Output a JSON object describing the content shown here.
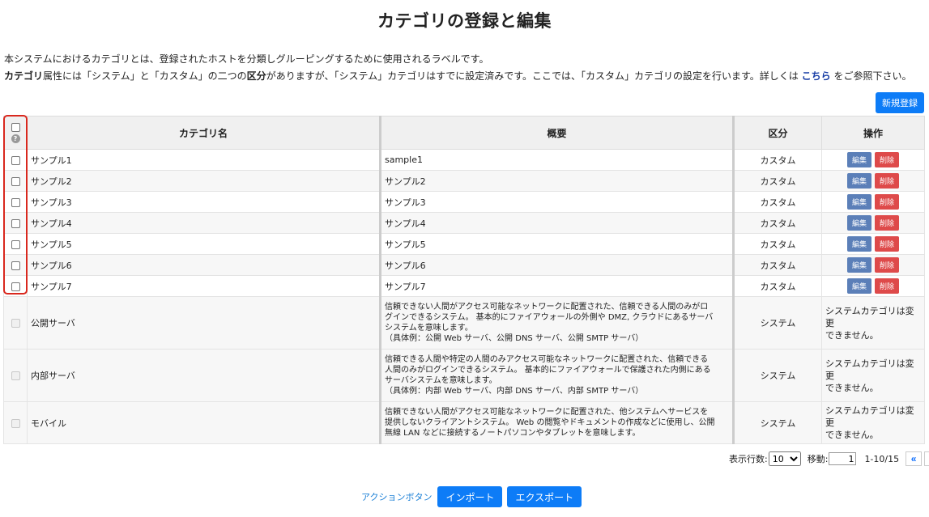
{
  "page": {
    "title": "カテゴリの登録と編集",
    "intro_line1": "本システムにおけるカテゴリとは、登録されたホストを分類しグルーピングするために使用されるラベルです。",
    "intro_line2": {
      "bold1": "カテゴリ",
      "t1": "属性には「システム」と「カスタム」の二つの",
      "bold2": "区分",
      "t2": "がありますが、「システム」カテゴリはすでに設定済みです。ここでは、「カスタム」カテゴリの設定を行います。詳しくは ",
      "link": "こちら",
      "t3": " をご参照下さい。"
    },
    "new_button": "新規登録"
  },
  "table": {
    "headers": {
      "name": "カテゴリ名",
      "summary": "概要",
      "division": "区分",
      "ops": "操作"
    },
    "edit_label": "編集",
    "delete_label": "削除",
    "custom_rows": [
      {
        "name": "サンプル1",
        "summary": "sample1",
        "division": "カスタム"
      },
      {
        "name": "サンプル2",
        "summary": "サンプル2",
        "division": "カスタム"
      },
      {
        "name": "サンプル3",
        "summary": "サンプル3",
        "division": "カスタム"
      },
      {
        "name": "サンプル4",
        "summary": "サンプル4",
        "division": "カスタム"
      },
      {
        "name": "サンプル5",
        "summary": "サンプル5",
        "division": "カスタム"
      },
      {
        "name": "サンプル6",
        "summary": "サンプル6",
        "division": "カスタム"
      },
      {
        "name": "サンプル7",
        "summary": "サンプル7",
        "division": "カスタム"
      }
    ],
    "system_rows": [
      {
        "name": "公開サーバ",
        "summary_lines": [
          "信頼できない人間がアクセス可能なネットワークに配置された、信頼できる人間のみがロ",
          "グインできるシステム。 基本的にファイアウォールの外側や DMZ, クラウドにあるサーバ",
          "システムを意味します。",
          "（具体例：公開 Web サーバ、公開 DNS サーバ、公開 SMTP サーバ）"
        ],
        "division": "システム",
        "note_lines": [
          "システムカテゴリは変更",
          "できません。"
        ]
      },
      {
        "name": "内部サーバ",
        "summary_lines": [
          "信頼できる人間や特定の人間のみアクセス可能なネットワークに配置された、信頼できる",
          "人間のみがログインできるシステム。 基本的にファイアウォールで保護された内側にある",
          "サーバシステムを意味します。",
          "（具体例：内部 Web サーバ、内部 DNS サーバ、内部 SMTP サーバ）"
        ],
        "division": "システム",
        "note_lines": [
          "システムカテゴリは変更",
          "できません。"
        ]
      },
      {
        "name": "モバイル",
        "summary_lines": [
          "信頼できない人間がアクセス可能なネットワークに配置された、他システムへサービスを",
          "提供しないクライアントシステム。 Web の閲覧やドキュメントの作成などに使用し、公開",
          "無線 LAN などに接続するノートパソコンやタブレットを意味します。"
        ],
        "division": "システム",
        "note_lines": [
          "システムカテゴリは変更",
          "できません。"
        ]
      }
    ]
  },
  "pager": {
    "rows_label": "表示行数:",
    "rows_value": "10",
    "move_label": "移動:",
    "move_value": "1",
    "range": "1-10/15",
    "prev_glyph": "«",
    "next_glyph": "»"
  },
  "actions": {
    "link": "アクションボタン",
    "import": "インポート",
    "export": "エクスポート"
  },
  "colors": {
    "primary": "#0d7cf7",
    "edit": "#5b7fb8",
    "delete": "#de4a4a",
    "highlight": "#d9281e"
  }
}
